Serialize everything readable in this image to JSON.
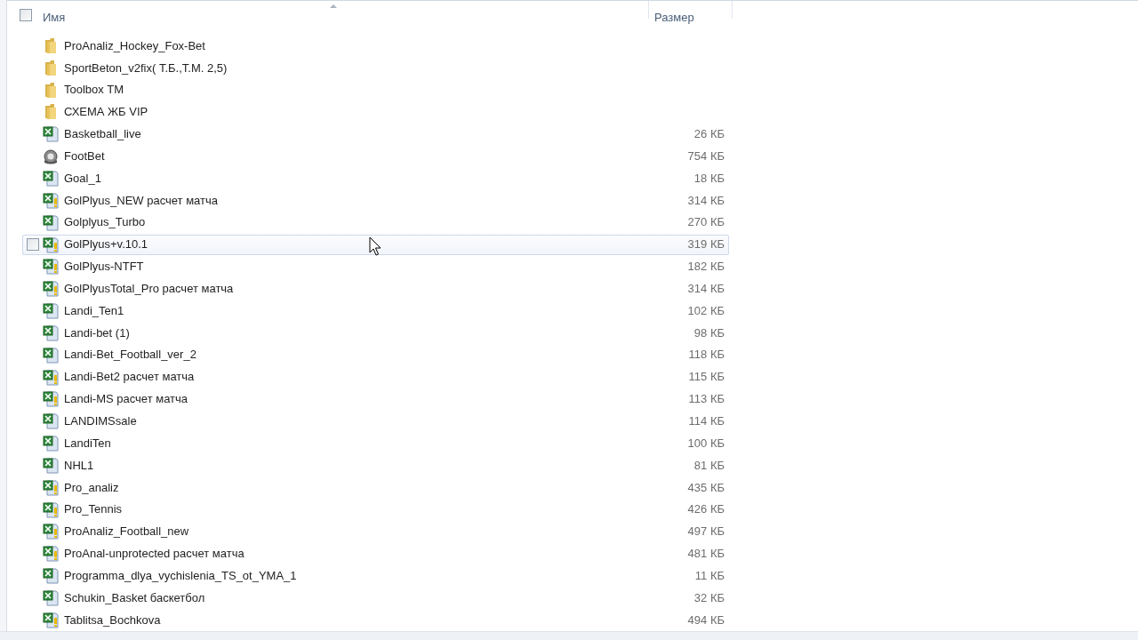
{
  "header": {
    "select_all_checked": false,
    "columns": [
      {
        "label": "Имя",
        "sorted": true
      },
      {
        "label": "Размер",
        "sorted": false
      }
    ]
  },
  "rows": [
    {
      "kind": "folder",
      "name": "ProAnaliz_Hockey_Fox-Bet",
      "hovered": false
    },
    {
      "kind": "folder",
      "name": "SportBeton_v2fix( Т.Б.,Т.М. 2,5)",
      "hovered": false
    },
    {
      "kind": "folder",
      "name": "Toolbox TM",
      "hovered": false
    },
    {
      "kind": "folder",
      "name": "СХЕМА ЖБ VIP",
      "hovered": false
    },
    {
      "kind": "excel",
      "name": "Basketball_live",
      "size": "26 КБ",
      "hovered": false
    },
    {
      "kind": "app",
      "name": "FootBet",
      "size": "754 КБ",
      "hovered": false
    },
    {
      "kind": "excel",
      "name": "Goal_1",
      "size": "18 КБ",
      "hovered": false
    },
    {
      "kind": "excel-macro",
      "name": "GolPlyus_NEW расчет матча",
      "size": "314 КБ",
      "hovered": false
    },
    {
      "kind": "excel",
      "name": "Golplyus_Turbo",
      "size": "270 КБ",
      "hovered": false
    },
    {
      "kind": "excel-macro",
      "name": "GolPlyus+v.10.1",
      "size": "319 КБ",
      "hovered": true,
      "checked": false
    },
    {
      "kind": "excel-macro",
      "name": "GolPlyus-NTFT",
      "size": "182 КБ",
      "hovered": false
    },
    {
      "kind": "excel-macro",
      "name": "GolPlyusTotal_Pro расчет матча",
      "size": "314 КБ",
      "hovered": false
    },
    {
      "kind": "excel",
      "name": "Landi_Ten1",
      "size": "102 КБ",
      "hovered": false
    },
    {
      "kind": "excel",
      "name": "Landi-bet (1)",
      "size": "98 КБ",
      "hovered": false
    },
    {
      "kind": "excel",
      "name": "Landi-Bet_Football_ver_2",
      "size": "118 КБ",
      "hovered": false
    },
    {
      "kind": "excel-macro",
      "name": "Landi-Bet2 расчет матча",
      "size": "115 КБ",
      "hovered": false
    },
    {
      "kind": "excel-macro",
      "name": "Landi-MS расчет матча",
      "size": "113 КБ",
      "hovered": false
    },
    {
      "kind": "excel",
      "name": "LANDIMSsale",
      "size": "114 КБ",
      "hovered": false
    },
    {
      "kind": "excel",
      "name": "LandiTen",
      "size": "100 КБ",
      "hovered": false
    },
    {
      "kind": "excel",
      "name": "NHL1",
      "size": "81 КБ",
      "hovered": false
    },
    {
      "kind": "excel-macro",
      "name": "Pro_analiz",
      "size": "435 КБ",
      "hovered": false
    },
    {
      "kind": "excel-macro",
      "name": "Pro_Tennis",
      "size": "426 КБ",
      "hovered": false
    },
    {
      "kind": "excel-macro",
      "name": "ProAnaliz_Football_new",
      "size": "497 КБ",
      "hovered": false
    },
    {
      "kind": "excel-macro",
      "name": "ProAnal-unprotected расчет матча",
      "size": "481 КБ",
      "hovered": false
    },
    {
      "kind": "excel",
      "name": "Programma_dlya_vychislenia_TS_ot_YMA_1",
      "size": "11 КБ",
      "hovered": false
    },
    {
      "kind": "excel",
      "name": "Schukin_Basket баскетбол",
      "size": "32 КБ",
      "hovered": false
    },
    {
      "kind": "excel-macro",
      "name": "Tablitsa_Bochkova",
      "size": "494 КБ",
      "hovered": false
    }
  ]
}
